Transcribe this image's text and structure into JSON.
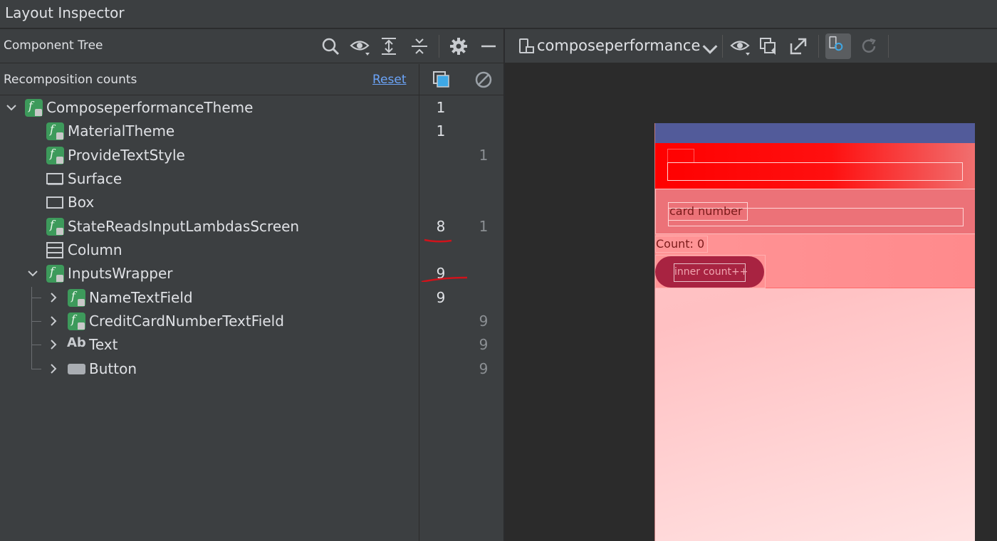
{
  "window": {
    "title": "Layout Inspector"
  },
  "component_tree": {
    "title": "Component Tree",
    "toolbar_icons": [
      "search-icon",
      "eye-icon",
      "expand-all-icon",
      "collapse-all-icon",
      "settings-icon",
      "minimize-icon"
    ],
    "recomposition": {
      "label": "Recomposition counts",
      "reset_label": "Reset",
      "col1_icon": "recomposition-count-icon",
      "col2_icon": "skip-count-icon"
    },
    "rows": [
      {
        "name": "ComposeperformanceTheme",
        "icon": "compose-function-icon",
        "count": "1",
        "skip": ""
      },
      {
        "name": "MaterialTheme",
        "icon": "compose-function-icon",
        "count": "1",
        "skip": ""
      },
      {
        "name": "ProvideTextStyle",
        "icon": "compose-function-icon",
        "count": "",
        "skip": "1"
      },
      {
        "name": "Surface",
        "icon": "surface-icon",
        "count": "",
        "skip": ""
      },
      {
        "name": "Box",
        "icon": "box-icon",
        "count": "",
        "skip": ""
      },
      {
        "name": "StateReadsInputLambdasScreen",
        "icon": "compose-function-icon",
        "count": "8",
        "skip": "1"
      },
      {
        "name": "Column",
        "icon": "column-icon",
        "count": "",
        "skip": ""
      },
      {
        "name": "InputsWrapper",
        "icon": "compose-function-icon",
        "count": "9",
        "skip": ""
      },
      {
        "name": "NameTextField",
        "icon": "compose-function-icon",
        "count": "9",
        "skip": ""
      },
      {
        "name": "CreditCardNumberTextField",
        "icon": "compose-function-icon",
        "count": "",
        "skip": "9"
      },
      {
        "name": "Text",
        "icon": "text-icon",
        "count": "",
        "skip": "9",
        "icon_label": "Ab"
      },
      {
        "name": "Button",
        "icon": "button-icon",
        "count": "",
        "skip": "9"
      }
    ]
  },
  "preview": {
    "process": "composeperformance",
    "toolbar_icons": [
      "device-icon",
      "chevron-down-icon",
      "eye-icon",
      "layer-icon",
      "export-icon",
      "live-update-icon",
      "refresh-icon"
    ],
    "name_field_text": "",
    "card_field_text": "card number",
    "count_text": "Count: 0",
    "button_text": "inner count++"
  },
  "colors": {
    "accent_link": "#6ba4f8",
    "compose_icon": "#3d9a5b",
    "annotation_red": "#d0131b"
  }
}
